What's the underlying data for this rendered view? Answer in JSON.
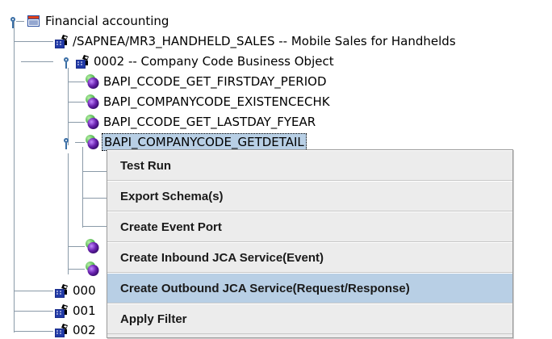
{
  "tree": {
    "root": {
      "label": "Financial accounting",
      "icon": "folder-icon"
    },
    "children": [
      {
        "label": "/SAPNEA/MR3_HANDHELD_SALES -- Mobile Sales for Handhelds",
        "icon": "business-object-icon"
      },
      {
        "label": "0002 -- Company Code Business Object",
        "icon": "business-object-icon",
        "children": [
          {
            "label": "BAPI_CCODE_GET_FIRSTDAY_PERIOD",
            "icon": "bapi-method-icon"
          },
          {
            "label": "BAPI_COMPANYCODE_EXISTENCECHK",
            "icon": "bapi-method-icon"
          },
          {
            "label": "BAPI_CCODE_GET_LASTDAY_FYEAR",
            "icon": "bapi-method-icon"
          },
          {
            "label": "BAPI_COMPANYCODE_GETDETAIL",
            "icon": "bapi-method-icon",
            "selected": true
          }
        ]
      },
      {
        "label": "000",
        "icon": "business-object-icon"
      },
      {
        "label": "001",
        "icon": "business-object-icon"
      },
      {
        "label": "002",
        "icon": "business-object-icon"
      }
    ]
  },
  "context_menu": {
    "items": [
      {
        "label": "Test Run"
      },
      {
        "label": "Export Schema(s)"
      },
      {
        "label": "Create Event Port"
      },
      {
        "label": "Create Inbound JCA Service(Event)"
      },
      {
        "label": "Create Outbound JCA Service(Request/Response)",
        "highlighted": true
      },
      {
        "label": "Apply Filter"
      }
    ]
  },
  "colors": {
    "selection": "#b8cfe5",
    "menu_background": "#ececec",
    "tree_lines": "#8a9aa8",
    "method_icon_purple": "#6a22b0",
    "method_icon_green": "#3aa83a"
  }
}
